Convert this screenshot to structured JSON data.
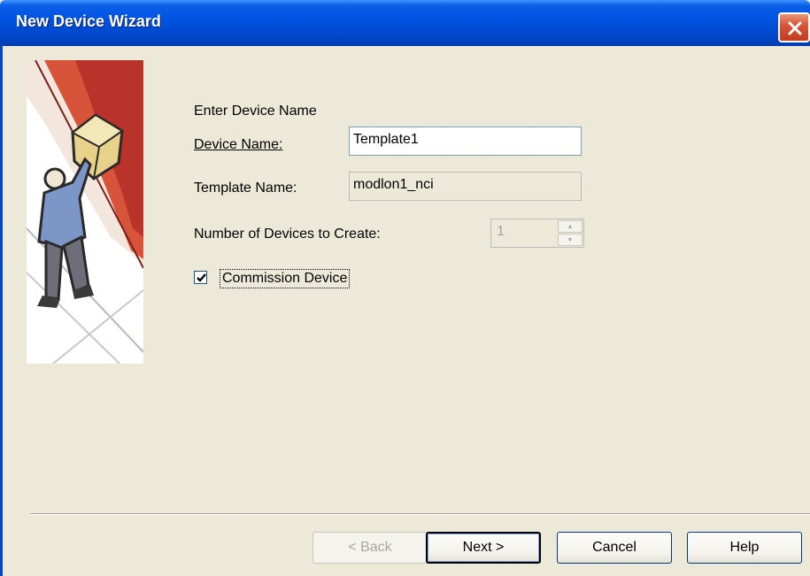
{
  "window": {
    "title": "New Device Wizard"
  },
  "form": {
    "heading": "Enter Device Name",
    "device_name_label": "Device Name:",
    "device_name_value": "Template1",
    "template_name_label": "Template Name:",
    "template_name_value": "modlon1_nci",
    "count_label": "Number of Devices to Create:",
    "count_value": "1",
    "commission_label": "Commission Device",
    "commission_checked": true
  },
  "buttons": {
    "back": "< Back",
    "next": "Next >",
    "cancel": "Cancel",
    "help": "Help"
  },
  "colors": {
    "titlebar": "#0054e3",
    "dialog_bg": "#ece9d8",
    "close": "#d8573a"
  },
  "icons": {
    "close": "close-icon",
    "check": "checkmark-icon"
  }
}
